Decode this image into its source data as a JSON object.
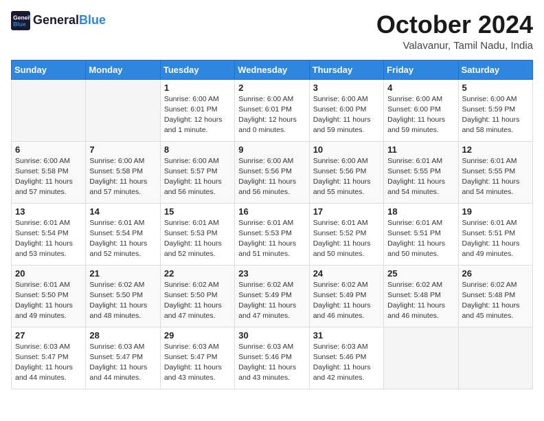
{
  "header": {
    "logo_line1": "General",
    "logo_line2": "Blue",
    "month_title": "October 2024",
    "location": "Valavanur, Tamil Nadu, India"
  },
  "weekdays": [
    "Sunday",
    "Monday",
    "Tuesday",
    "Wednesday",
    "Thursday",
    "Friday",
    "Saturday"
  ],
  "weeks": [
    [
      {
        "day": "",
        "info": ""
      },
      {
        "day": "",
        "info": ""
      },
      {
        "day": "1",
        "info": "Sunrise: 6:00 AM\nSunset: 6:01 PM\nDaylight: 12 hours\nand 1 minute."
      },
      {
        "day": "2",
        "info": "Sunrise: 6:00 AM\nSunset: 6:01 PM\nDaylight: 12 hours\nand 0 minutes."
      },
      {
        "day": "3",
        "info": "Sunrise: 6:00 AM\nSunset: 6:00 PM\nDaylight: 11 hours\nand 59 minutes."
      },
      {
        "day": "4",
        "info": "Sunrise: 6:00 AM\nSunset: 6:00 PM\nDaylight: 11 hours\nand 59 minutes."
      },
      {
        "day": "5",
        "info": "Sunrise: 6:00 AM\nSunset: 5:59 PM\nDaylight: 11 hours\nand 58 minutes."
      }
    ],
    [
      {
        "day": "6",
        "info": "Sunrise: 6:00 AM\nSunset: 5:58 PM\nDaylight: 11 hours\nand 57 minutes."
      },
      {
        "day": "7",
        "info": "Sunrise: 6:00 AM\nSunset: 5:58 PM\nDaylight: 11 hours\nand 57 minutes."
      },
      {
        "day": "8",
        "info": "Sunrise: 6:00 AM\nSunset: 5:57 PM\nDaylight: 11 hours\nand 56 minutes."
      },
      {
        "day": "9",
        "info": "Sunrise: 6:00 AM\nSunset: 5:56 PM\nDaylight: 11 hours\nand 56 minutes."
      },
      {
        "day": "10",
        "info": "Sunrise: 6:00 AM\nSunset: 5:56 PM\nDaylight: 11 hours\nand 55 minutes."
      },
      {
        "day": "11",
        "info": "Sunrise: 6:01 AM\nSunset: 5:55 PM\nDaylight: 11 hours\nand 54 minutes."
      },
      {
        "day": "12",
        "info": "Sunrise: 6:01 AM\nSunset: 5:55 PM\nDaylight: 11 hours\nand 54 minutes."
      }
    ],
    [
      {
        "day": "13",
        "info": "Sunrise: 6:01 AM\nSunset: 5:54 PM\nDaylight: 11 hours\nand 53 minutes."
      },
      {
        "day": "14",
        "info": "Sunrise: 6:01 AM\nSunset: 5:54 PM\nDaylight: 11 hours\nand 52 minutes."
      },
      {
        "day": "15",
        "info": "Sunrise: 6:01 AM\nSunset: 5:53 PM\nDaylight: 11 hours\nand 52 minutes."
      },
      {
        "day": "16",
        "info": "Sunrise: 6:01 AM\nSunset: 5:53 PM\nDaylight: 11 hours\nand 51 minutes."
      },
      {
        "day": "17",
        "info": "Sunrise: 6:01 AM\nSunset: 5:52 PM\nDaylight: 11 hours\nand 50 minutes."
      },
      {
        "day": "18",
        "info": "Sunrise: 6:01 AM\nSunset: 5:51 PM\nDaylight: 11 hours\nand 50 minutes."
      },
      {
        "day": "19",
        "info": "Sunrise: 6:01 AM\nSunset: 5:51 PM\nDaylight: 11 hours\nand 49 minutes."
      }
    ],
    [
      {
        "day": "20",
        "info": "Sunrise: 6:01 AM\nSunset: 5:50 PM\nDaylight: 11 hours\nand 49 minutes."
      },
      {
        "day": "21",
        "info": "Sunrise: 6:02 AM\nSunset: 5:50 PM\nDaylight: 11 hours\nand 48 minutes."
      },
      {
        "day": "22",
        "info": "Sunrise: 6:02 AM\nSunset: 5:50 PM\nDaylight: 11 hours\nand 47 minutes."
      },
      {
        "day": "23",
        "info": "Sunrise: 6:02 AM\nSunset: 5:49 PM\nDaylight: 11 hours\nand 47 minutes."
      },
      {
        "day": "24",
        "info": "Sunrise: 6:02 AM\nSunset: 5:49 PM\nDaylight: 11 hours\nand 46 minutes."
      },
      {
        "day": "25",
        "info": "Sunrise: 6:02 AM\nSunset: 5:48 PM\nDaylight: 11 hours\nand 46 minutes."
      },
      {
        "day": "26",
        "info": "Sunrise: 6:02 AM\nSunset: 5:48 PM\nDaylight: 11 hours\nand 45 minutes."
      }
    ],
    [
      {
        "day": "27",
        "info": "Sunrise: 6:03 AM\nSunset: 5:47 PM\nDaylight: 11 hours\nand 44 minutes."
      },
      {
        "day": "28",
        "info": "Sunrise: 6:03 AM\nSunset: 5:47 PM\nDaylight: 11 hours\nand 44 minutes."
      },
      {
        "day": "29",
        "info": "Sunrise: 6:03 AM\nSunset: 5:47 PM\nDaylight: 11 hours\nand 43 minutes."
      },
      {
        "day": "30",
        "info": "Sunrise: 6:03 AM\nSunset: 5:46 PM\nDaylight: 11 hours\nand 43 minutes."
      },
      {
        "day": "31",
        "info": "Sunrise: 6:03 AM\nSunset: 5:46 PM\nDaylight: 11 hours\nand 42 minutes."
      },
      {
        "day": "",
        "info": ""
      },
      {
        "day": "",
        "info": ""
      }
    ]
  ]
}
